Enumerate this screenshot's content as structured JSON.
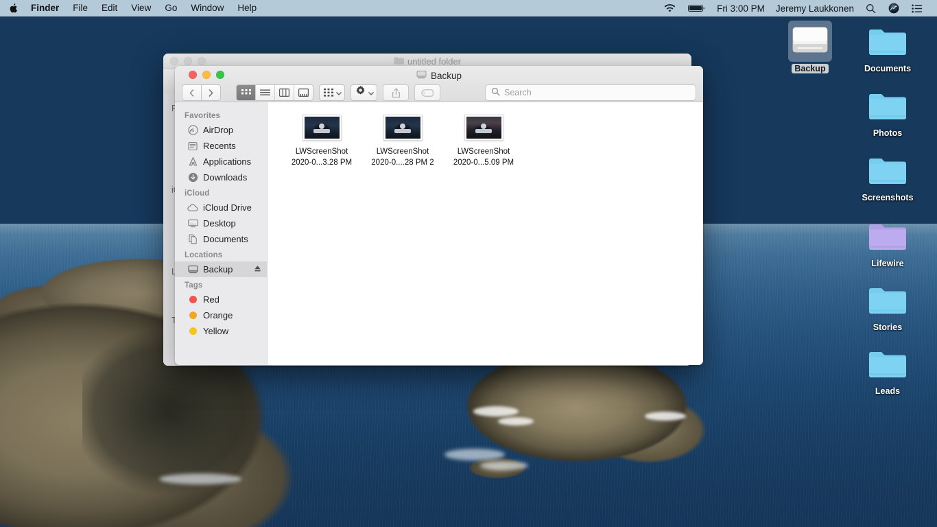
{
  "menubar": {
    "apple_icon": "apple-logo",
    "items": [
      {
        "label": "Finder",
        "bold": true
      },
      {
        "label": "File",
        "bold": false
      },
      {
        "label": "Edit",
        "bold": false
      },
      {
        "label": "View",
        "bold": false
      },
      {
        "label": "Go",
        "bold": false
      },
      {
        "label": "Window",
        "bold": false
      },
      {
        "label": "Help",
        "bold": false
      }
    ],
    "status": {
      "wifi_icon": "wifi-icon",
      "battery_icon": "battery-icon",
      "clock": "Fri 3:00 PM",
      "username": "Jeremy Laukkonen",
      "spotlight_icon": "search-icon",
      "siri_icon": "siri-icon",
      "control_center_icon": "control-center-icon"
    }
  },
  "desktop": {
    "icons": [
      {
        "label": "Backup",
        "type": "drive",
        "selected": true,
        "color": "#e9e9e9"
      },
      {
        "label": "Documents",
        "type": "folder",
        "selected": false,
        "color": "#74cef0"
      },
      {
        "label": "Photos",
        "type": "folder",
        "selected": false,
        "color": "#74cef0"
      },
      {
        "label": "Screenshots",
        "type": "folder",
        "selected": false,
        "color": "#74cef0"
      },
      {
        "label": "Lifewire",
        "type": "folder",
        "selected": false,
        "color": "#b8a6e8"
      },
      {
        "label": "Stories",
        "type": "folder",
        "selected": false,
        "color": "#74cef0"
      },
      {
        "label": "Leads",
        "type": "folder",
        "selected": false,
        "color": "#74cef0"
      }
    ]
  },
  "background_window": {
    "title": "untitled folder",
    "title_icon": "folder-icon",
    "sidebar_fragments": [
      "Fa",
      "iC",
      "Lo",
      "Ta"
    ]
  },
  "finder_window": {
    "title": "Backup",
    "title_icon": "drive-icon",
    "toolbar": {
      "back_icon": "chevron-left-icon",
      "forward_icon": "chevron-right-icon",
      "view_icon_label": "icon-view",
      "view_list_label": "list-view",
      "view_column_label": "column-view",
      "view_gallery_label": "gallery-view",
      "active_view": "icon-view",
      "group_icon": "group-by-icon",
      "action_icon": "gear-icon",
      "share_icon": "share-icon",
      "tags_icon": "tag-icon"
    },
    "search": {
      "placeholder": "Search",
      "value": "",
      "icon": "search-icon"
    },
    "sidebar": {
      "sections": [
        {
          "header": "Favorites",
          "items": [
            {
              "label": "AirDrop",
              "icon": "airdrop-icon",
              "selected": false
            },
            {
              "label": "Recents",
              "icon": "recents-icon",
              "selected": false
            },
            {
              "label": "Applications",
              "icon": "applications-icon",
              "selected": false
            },
            {
              "label": "Downloads",
              "icon": "downloads-icon",
              "selected": false
            }
          ]
        },
        {
          "header": "iCloud",
          "items": [
            {
              "label": "iCloud Drive",
              "icon": "cloud-icon",
              "selected": false
            },
            {
              "label": "Desktop",
              "icon": "desktop-icon",
              "selected": false
            },
            {
              "label": "Documents",
              "icon": "documents-icon",
              "selected": false
            }
          ]
        },
        {
          "header": "Locations",
          "items": [
            {
              "label": "Backup",
              "icon": "drive-icon",
              "selected": true,
              "eject": true
            }
          ]
        },
        {
          "header": "Tags",
          "items": [
            {
              "label": "Red",
              "icon": "tag-dot",
              "color": "#f2544a",
              "selected": false
            },
            {
              "label": "Orange",
              "icon": "tag-dot",
              "color": "#f5a623",
              "selected": false
            },
            {
              "label": "Yellow",
              "icon": "tag-dot",
              "color": "#f5c518",
              "selected": false
            }
          ]
        }
      ]
    },
    "files": [
      {
        "name_line1": "LWScreenShot",
        "name_line2": "2020-0...3.28 PM",
        "thumb": "screenshot-dark"
      },
      {
        "name_line1": "LWScreenShot",
        "name_line2": "2020-0....28 PM 2",
        "thumb": "screenshot-dark"
      },
      {
        "name_line1": "LWScreenShot",
        "name_line2": "2020-0...5.09 PM",
        "thumb": "screenshot-warm"
      }
    ]
  }
}
